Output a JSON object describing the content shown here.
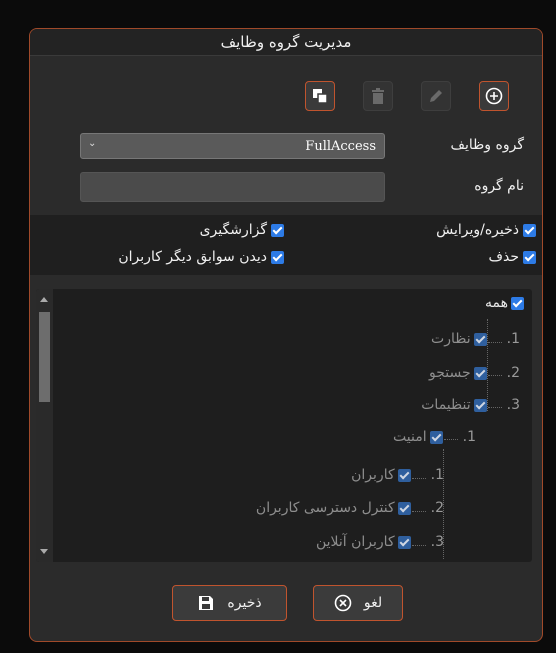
{
  "dialog": {
    "title": "مدیریت گروه وظایف"
  },
  "toolbar": {
    "add_icon": "plus-circle-icon",
    "edit_icon": "pencil-icon",
    "delete_icon": "trash-icon",
    "copy_icon": "copy-icon"
  },
  "form": {
    "group_label": "گروه وظایف",
    "group_value": "FullAccess",
    "name_label": "نام گروه",
    "name_value": ""
  },
  "permissions": {
    "save_edit": "ذخیره/ویرایش",
    "reporting": "گزارشگیری",
    "delete": "حذف",
    "view_others": "دیدن سوابق دیگر کاربران"
  },
  "tree": {
    "all": "همه",
    "items": [
      {
        "num": "1.",
        "label": "نظارت"
      },
      {
        "num": "2.",
        "label": "جستجو"
      },
      {
        "num": "3.",
        "label": "تنظیمات"
      },
      {
        "num": "1.",
        "label": "امنیت"
      },
      {
        "num": "1.",
        "label": "کاربران"
      },
      {
        "num": "2.",
        "label": "کنترل دسترسی کاربران"
      },
      {
        "num": "3.",
        "label": "کاربران آنلاین"
      }
    ]
  },
  "footer": {
    "cancel_label": "لغو",
    "save_label": "ذخیره"
  },
  "colors": {
    "accent": "#c0542e",
    "checkbox": "#2d7be6"
  }
}
